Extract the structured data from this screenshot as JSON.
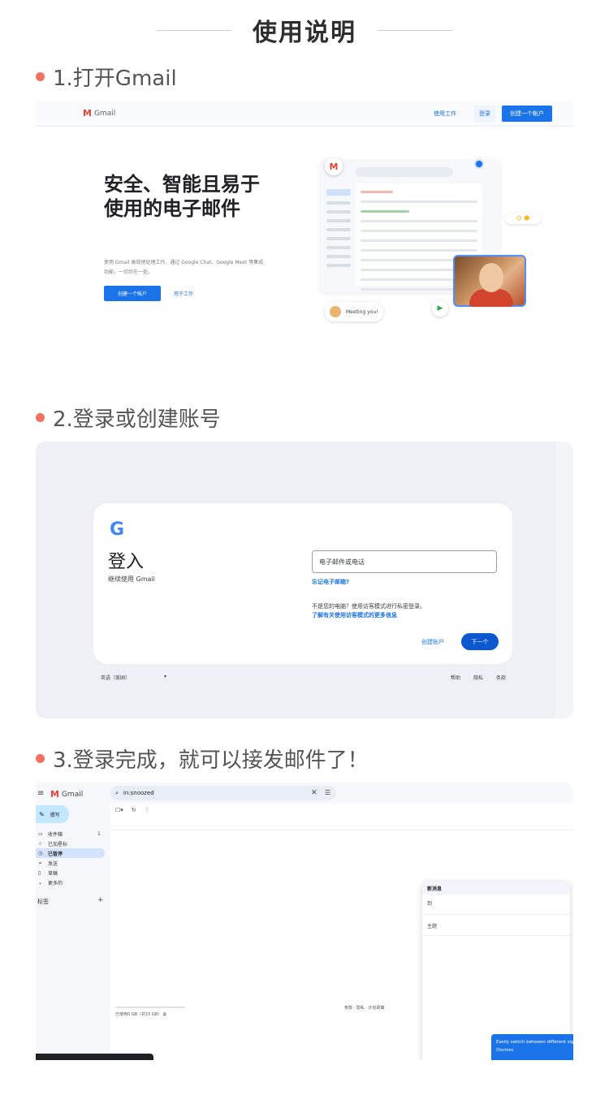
{
  "header": {
    "title": "使用说明"
  },
  "steps": [
    {
      "label": "1.打开Gmail"
    },
    {
      "label": "2.登录或创建账号"
    },
    {
      "label": "3.登录完成，就可以接发邮件了！"
    }
  ],
  "landing": {
    "brand": "Gmail",
    "nav_signin": "登录",
    "nav_login": "使用工作",
    "nav_create": "创建一个帐户",
    "headline": "安全、智能且易于使用的电子邮件",
    "description": "使用 Gmail 高效地处理工作，通过 Google Chat、Google Meet 等集成功能，一切尽在一处。",
    "cta_create": "创建一个帐户",
    "cta_work": "用于工作",
    "chat_text": "Meeting you!",
    "colors": {
      "accent": "#1a73e8",
      "gmail_red": "#ea4335"
    }
  },
  "signin": {
    "google_logo": "G",
    "title": "登入",
    "subtitle": "继续使用 Gmail",
    "email_placeholder": "电子邮件或电话",
    "forgot_email": "忘记电子邮箱?",
    "guest_notice": "不是您的电脑？使用访客模式进行私密登录。",
    "guest_link": "了解有关使用访客模式的更多信息",
    "create_account": "创建账户",
    "next_button": "下一个",
    "language": "英语（美国）",
    "footer": {
      "help": "帮助",
      "privacy": "隐私",
      "terms": "条款"
    }
  },
  "inbox": {
    "brand": "Gmail",
    "search_value": "in:snoozed",
    "compose": "撰写",
    "nav": [
      {
        "label": "收件箱",
        "count": "1"
      },
      {
        "label": "已加星标",
        "count": ""
      },
      {
        "label": "已暂停",
        "count": ""
      },
      {
        "label": "发送",
        "count": ""
      },
      {
        "label": "草稿",
        "count": ""
      },
      {
        "label": "更多的",
        "count": ""
      }
    ],
    "labels_heading": "标签",
    "storage_text": "已使用0 GB（共15 GB）",
    "terms_text": "条款 · 隐私 · 计划政策",
    "draft_title": "新消息",
    "draft_to": "到",
    "draft_subject": "主题",
    "toast_text": "Easily switch between different signatures",
    "toast_action": "Dismiss"
  }
}
